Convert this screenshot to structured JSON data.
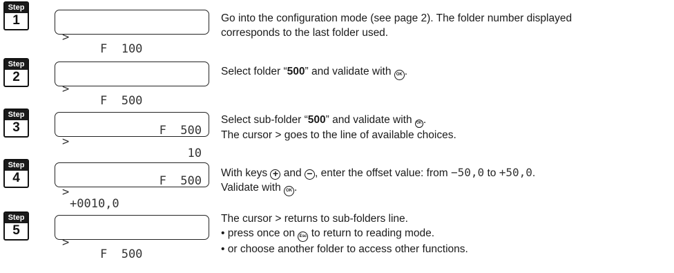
{
  "steps": [
    {
      "badge_label": "Step",
      "number": "1",
      "lcd": {
        "line1": "",
        "line2_cursor": ">",
        "line2_text": "F  100"
      },
      "text": {
        "line1": "Go into the configuration mode (see page 2). The folder number displayed",
        "line2": "corresponds to the last folder used."
      }
    },
    {
      "badge_label": "Step",
      "number": "2",
      "lcd": {
        "line1": "",
        "line2_cursor": ">",
        "line2_text": "F  500"
      },
      "text": {
        "pre": "Select folder  “",
        "bold": "500",
        "post": "” and validate with ",
        "key": "OK",
        "end": "."
      }
    },
    {
      "badge_label": "Step",
      "number": "3",
      "lcd": {
        "line1": "F  500",
        "line2_cursor": ">",
        "line2_value": "10"
      },
      "text": {
        "pre": "Select sub-folder “",
        "bold": "500",
        "post": "” and validate with ",
        "key": "OK",
        "end": ".",
        "line2": "The cursor > goes to the line of available choices."
      }
    },
    {
      "badge_label": "Step",
      "number": "4",
      "lcd": {
        "line1": "F  500",
        "line2_cursor": ">",
        "line2_value": "+0010,0"
      },
      "text": {
        "pre": "With keys ",
        "plus_key": "+",
        "mid": " and ",
        "minus_key": "−",
        "post": ", enter the offset value: from ",
        "from_value": "−50,0",
        "to_word": " to ",
        "to_value": "+50,0",
        "end": ".",
        "line2_pre": "Validate with ",
        "line2_key": "OK",
        "line2_end": "."
      }
    },
    {
      "badge_label": "Step",
      "number": "5",
      "lcd": {
        "line1": "",
        "line2_cursor": ">",
        "line2_text": "F  500"
      },
      "text": {
        "line1": "The cursor > returns to sub-folders line.",
        "line2_pre": "• press once on ",
        "line2_key": "Esc",
        "line2_post": "  to return to reading mode.",
        "line3": "• or choose another folder to access other functions."
      }
    }
  ]
}
